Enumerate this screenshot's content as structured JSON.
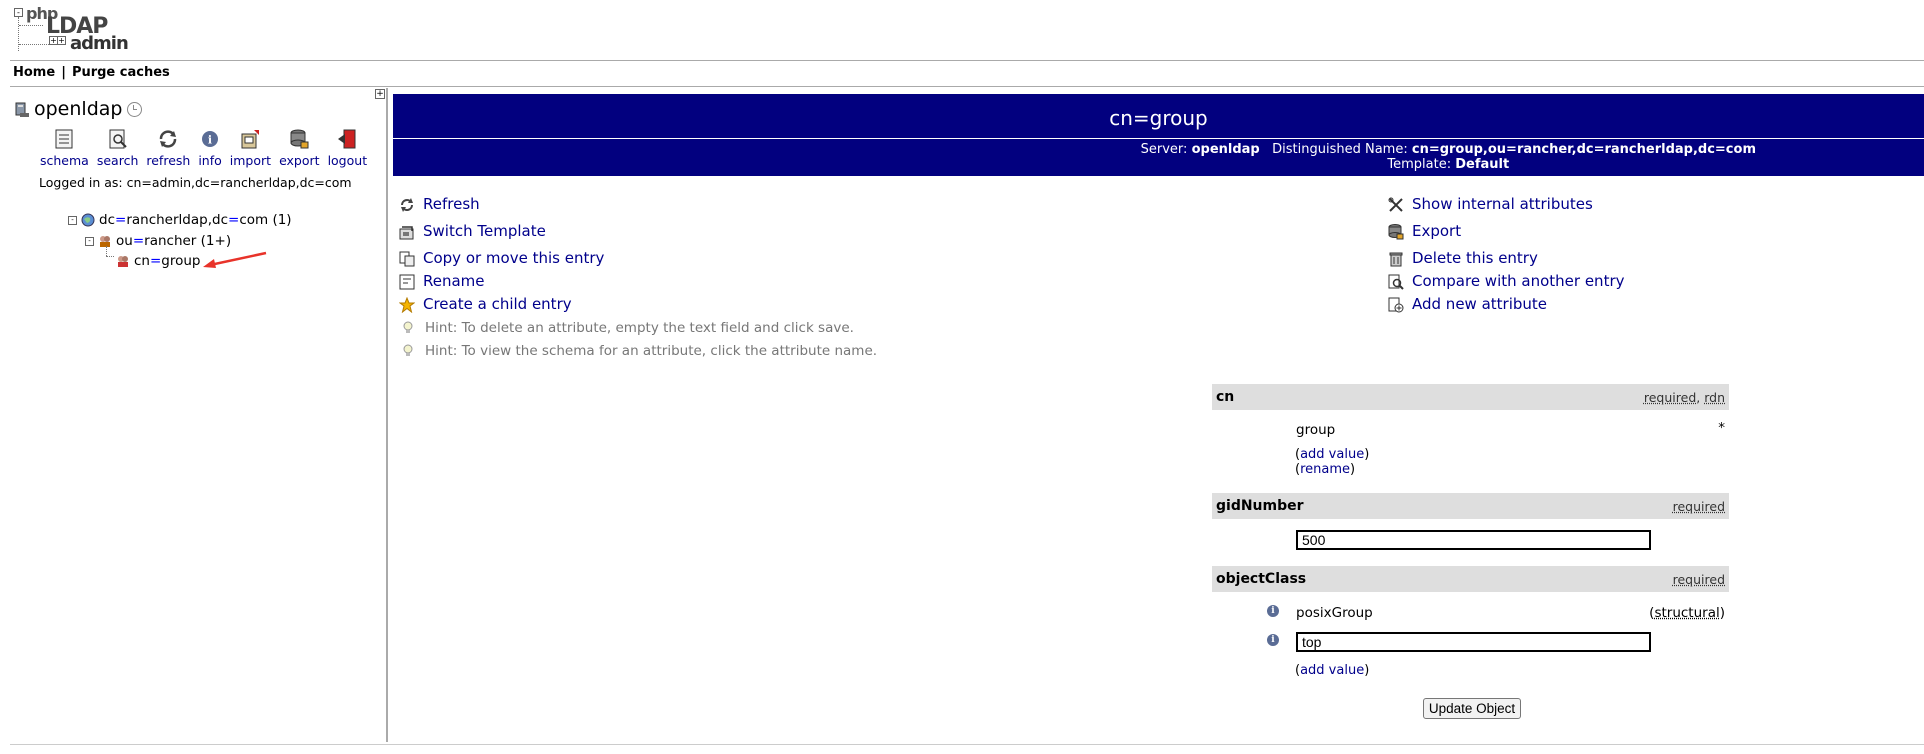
{
  "header": {
    "logo_php": "php",
    "logo_ldap": "LDAP",
    "logo_admin": "admin",
    "menu": [
      {
        "label": "Home"
      },
      {
        "label": "Purge caches"
      }
    ],
    "menu_separator": "|"
  },
  "sidebar": {
    "server_name": "openldap",
    "quick_links": [
      {
        "label": "schema",
        "icon": "schema-icon"
      },
      {
        "label": "search",
        "icon": "search-icon"
      },
      {
        "label": "refresh",
        "icon": "refresh-icon"
      },
      {
        "label": "info",
        "icon": "info-icon"
      },
      {
        "label": "import",
        "icon": "import-icon"
      },
      {
        "label": "export",
        "icon": "export-icon"
      },
      {
        "label": "logout",
        "icon": "logout-icon"
      }
    ],
    "logged_in": "Logged in as: cn=admin,dc=rancherldap,dc=com",
    "tree": {
      "root": {
        "a1": "dc",
        "a2": "rancherldap",
        "b1": "dc",
        "b2": "com",
        "count": "(1)",
        "sep": ","
      },
      "ou": {
        "k": "ou",
        "v": "rancher",
        "count": "(1+)"
      },
      "cn": {
        "k": "cn",
        "v": "group"
      }
    }
  },
  "entry": {
    "title": "cn=group",
    "server_label": "Server:",
    "server_value": "openldap",
    "dn_label": "Distinguished Name:",
    "dn_value": "cn=group,ou=rancher,dc=rancherldap,dc=com",
    "template_label": "Template:",
    "template_value": "Default"
  },
  "actions_left": [
    {
      "label": "Refresh",
      "icon": "refresh-icon"
    },
    {
      "label": "Switch Template",
      "icon": "switch-template-icon"
    },
    {
      "label": "Copy or move this entry",
      "icon": "copy-icon"
    },
    {
      "label": "Rename",
      "icon": "rename-icon"
    },
    {
      "label": "Create a child entry",
      "icon": "star-icon"
    }
  ],
  "actions_right": [
    {
      "label": "Show internal attributes",
      "icon": "tools-icon"
    },
    {
      "label": "Export",
      "icon": "export-icon"
    },
    {
      "label": "Delete this entry",
      "icon": "trash-icon"
    },
    {
      "label": "Compare with another entry",
      "icon": "compare-icon"
    },
    {
      "label": "Add new attribute",
      "icon": "add-attribute-icon"
    }
  ],
  "hints": [
    "Hint: To delete an attribute, empty the text field and click save.",
    "Hint: To view the schema for an attribute, click the attribute name."
  ],
  "attributes": {
    "cn": {
      "name": "cn",
      "flag1": "required",
      "flag_sep": ",",
      "flag2": "rdn",
      "value": "group",
      "marker": "*",
      "add_value": "add value",
      "rename": "rename"
    },
    "gid": {
      "name": "gidNumber",
      "flag": "required",
      "value": "500"
    },
    "oc": {
      "name": "objectClass",
      "flag": "required",
      "value1": "posixGroup",
      "value1_note": "structural",
      "value2": "top",
      "add_value": "add value"
    }
  },
  "paren_open": "(",
  "paren_close": ")",
  "submit_label": "Update Object",
  "colors": {
    "title_bar": "#02007f",
    "link": "#00008b",
    "annotation_arrow": "#e8332a"
  }
}
